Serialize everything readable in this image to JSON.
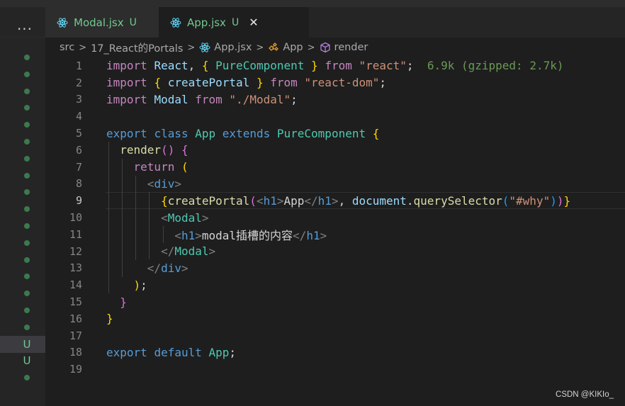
{
  "toolbar": {
    "more_label": "···"
  },
  "tabs": [
    {
      "label": "Modal.jsx",
      "status": "U",
      "icon": "react-icon",
      "active": false
    },
    {
      "label": "App.jsx",
      "status": "U",
      "icon": "react-icon",
      "active": true,
      "close": "✕"
    }
  ],
  "breadcrumb": {
    "items": [
      {
        "label": "src",
        "icon": ""
      },
      {
        "label": "17_React的Portals",
        "icon": ""
      },
      {
        "label": "App.jsx",
        "icon": "react-icon"
      },
      {
        "label": "App",
        "icon": "class-icon"
      },
      {
        "label": "render",
        "icon": "method-cube-icon"
      }
    ],
    "separator": ">"
  },
  "editor": {
    "line_numbers": [
      "1",
      "2",
      "3",
      "4",
      "5",
      "6",
      "7",
      "8",
      "9",
      "10",
      "11",
      "12",
      "13",
      "14",
      "15",
      "16",
      "17",
      "18",
      "19"
    ],
    "current_line": 9,
    "import_size_hint": "6.9k (gzipped: 2.7k)"
  },
  "gutter": {
    "markers": [
      "dot",
      "dot",
      "dot",
      "dot",
      "dot",
      "dot",
      "dot",
      "dot",
      "dot",
      "dot",
      "dot",
      "dot",
      "dot",
      "dot",
      "dot",
      "dot",
      "dot",
      "U",
      "U",
      "dot"
    ]
  },
  "colors": {
    "background": "#1e1e1e",
    "modified_untracked": "#73c991",
    "keyword": "#569cd6",
    "control_keyword": "#c586c0",
    "type": "#4ec9b0",
    "string": "#ce9178",
    "variable": "#9cdcfe",
    "function": "#dcdcaa"
  },
  "watermark": "CSDN @KIKIo_"
}
